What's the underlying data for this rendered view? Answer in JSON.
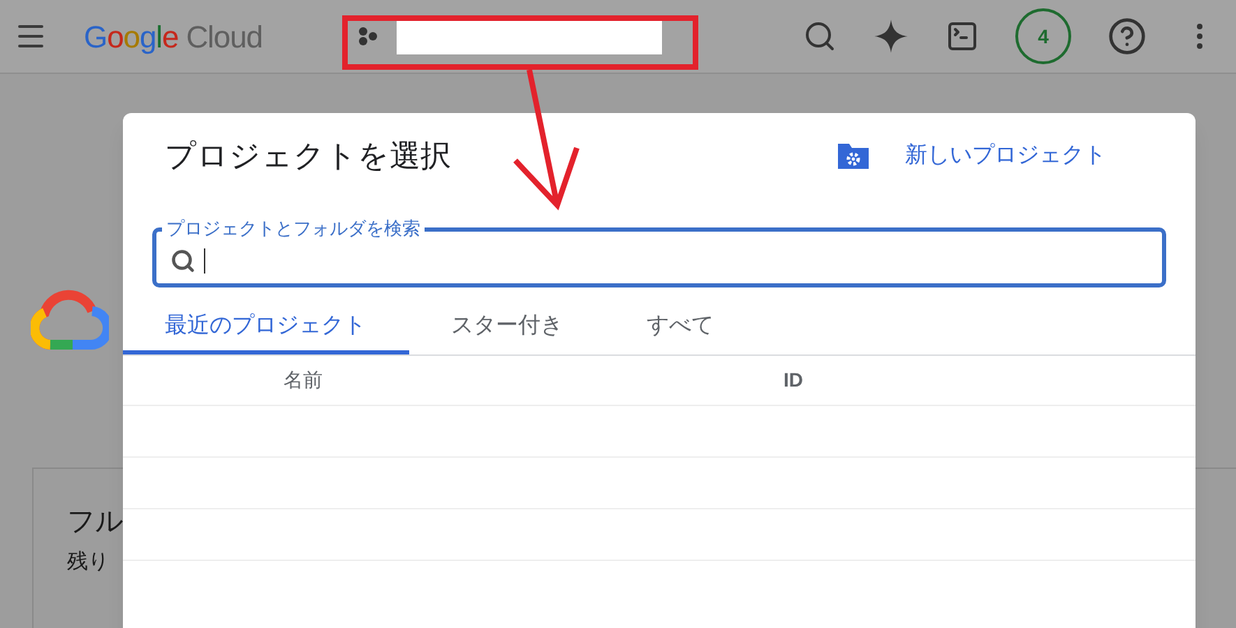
{
  "topbar": {
    "logo": {
      "word_1": "Google",
      "word_2": "Cloud"
    },
    "notifications_badge": "4"
  },
  "background_card": {
    "title": "フル",
    "text": "残り"
  },
  "dialog": {
    "title": "プロジェクトを選択",
    "new_project": "新しいプロジェクト",
    "search": {
      "label": "プロジェクトとフォルダを検索"
    },
    "tabs": [
      {
        "label": "最近のプロジェクト",
        "selected": true
      },
      {
        "label": "スター付き",
        "selected": false
      },
      {
        "label": "すべて",
        "selected": false
      }
    ],
    "table": {
      "columns": [
        "名前",
        "ID"
      ]
    }
  }
}
